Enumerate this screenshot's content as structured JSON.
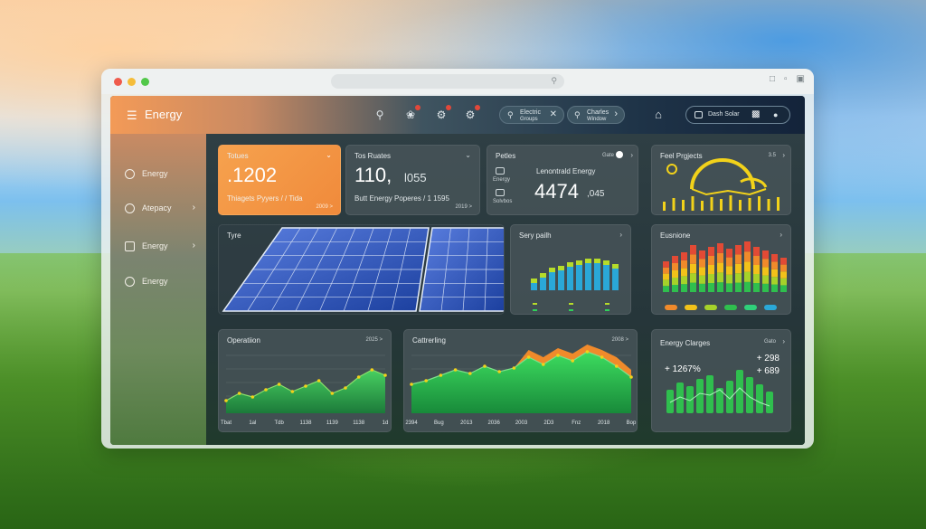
{
  "app": {
    "brand": "Energy"
  },
  "search": {
    "label_top": "Electric",
    "label_bottom": "Groups"
  },
  "filter": {
    "label_top": "Charles",
    "label_bottom": "Window"
  },
  "account": {
    "label": "Dash Solar"
  },
  "sidebar": {
    "items": [
      {
        "label": "Energy"
      },
      {
        "label": "Atepacy"
      },
      {
        "label": "Energy"
      },
      {
        "label": "Energy"
      }
    ]
  },
  "cards": {
    "totals": {
      "title": "Totues",
      "value": ".1202",
      "subtitle": "Thiagets Pyyers  / / Tida",
      "footer": "2009 >"
    },
    "top_routes": {
      "title": "Tos Ruates",
      "value": "110,",
      "value_suffix": "l055",
      "subtitle": "Butt Energy Poperes  / 1 1595",
      "footer": "2019 >"
    },
    "peties": {
      "title": "Petles",
      "link": "Gate",
      "heading": "Lenontrald Energy",
      "value": "4474",
      "value_suffix": ",045",
      "legend_a": "Energy",
      "legend_b": "Solvbos"
    },
    "feel_projects": {
      "title": "Feel Prgjects",
      "link": "3.5"
    },
    "solar": {
      "title": "Tyre"
    },
    "sery_path": {
      "title": "Sery pailh"
    },
    "eusnione": {
      "title": "Eusnione"
    },
    "operation": {
      "title": "Operatiion",
      "link": "2025 >",
      "x_labels": [
        "Tbat",
        "1al",
        "Tdb",
        "1138",
        "1139",
        "1138",
        "1d"
      ]
    },
    "cattering": {
      "title": "Cattrerling",
      "link": "2008 >",
      "x_labels": [
        "2394",
        "Bug",
        "2013",
        "2036",
        "2003",
        "2D3",
        "Fnz",
        "2018",
        "Bop"
      ]
    },
    "energy_clarges": {
      "title": "Energy Clarges",
      "link": "Gato",
      "stat_a": "+ 1267%",
      "stat_b": "+ 298",
      "stat_c": "+ 689"
    }
  },
  "colors": {
    "accent_orange": "#f39a57",
    "green": "#2fd05a",
    "teal": "#2aa8d8",
    "yellow": "#f2d21a"
  }
}
